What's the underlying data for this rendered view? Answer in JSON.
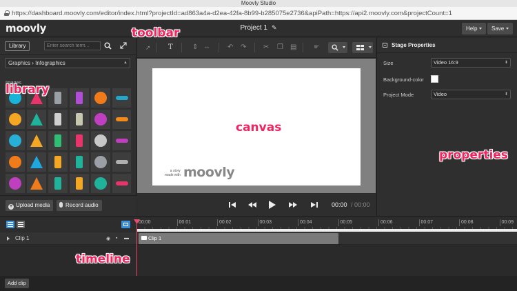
{
  "window": {
    "title": "Moovly Studio",
    "url": "https://dashboard.moovly.com/editor/index.html?projectId=ad863a4a-d2ea-42fa-8b99-b285075e2736&apiPath=https://api2.moovly.com&projectCount=1"
  },
  "header": {
    "logo": "moovly",
    "project_title": "Project 1",
    "help_label": "Help",
    "save_label": "Save"
  },
  "library": {
    "tab_label": "Library",
    "search_placeholder": "Enter search term...",
    "breadcrumb": "Graphics  ›  Infographics",
    "section_label": "Images",
    "upload_label": "Upload media",
    "record_label": "Record audio",
    "thumbnails": [
      "sign-icon",
      "lightning-icon",
      "android-icon",
      "bracket-icon",
      "apple-icon",
      "wave-icon",
      "arrow-icon",
      "balloon-icon",
      "stamp-icon",
      "leaf-icon",
      "bottle-icon",
      "splash-icon",
      "bicycle-icon",
      "pencil-icon",
      "bird-icon",
      "egg-icon",
      "bowling-icon",
      "bottle2-icon",
      "figure-icon",
      "bracket2-icon",
      "bridge-icon",
      "briefcase-icon",
      "brush-icon",
      "feather-icon",
      "bucket-icon",
      "rabbit-icon",
      "hedgehog-icon",
      "cake-icon",
      "candle-icon",
      "cash-icon"
    ]
  },
  "canvas": {
    "watermark_small": "a story\nmade with",
    "watermark_logo": "moovly"
  },
  "playback": {
    "current_time": "00:00",
    "total_time": "/ 00:00"
  },
  "properties": {
    "heading": "Stage Properties",
    "size_label": "Size",
    "size_value": "Video 16:9",
    "bg_label": "Background-color",
    "mode_label": "Project Mode",
    "mode_value": "Video"
  },
  "timeline": {
    "ticks": [
      "00:00",
      "00:01",
      "00:02",
      "00:03",
      "00:04",
      "00:05",
      "00:06",
      "00:07",
      "00:08",
      "00:09"
    ],
    "layer_name": "Clip 1",
    "clip_label": "Clip 1",
    "add_clip_label": "Add clip"
  },
  "annotations": {
    "toolbar": "toolbar",
    "library": "library",
    "canvas": "canvas",
    "properties": "properties",
    "timeline": "timeline"
  },
  "colors": {
    "accent_blue": "#3b8fd9",
    "annotation_pink": "#f0245f",
    "playhead": "#e84a6a"
  }
}
